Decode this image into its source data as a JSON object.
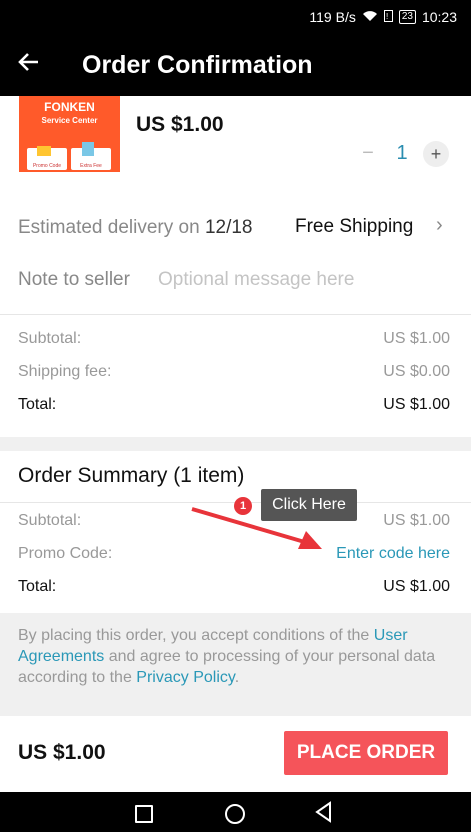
{
  "status_bar": {
    "speed": "119 B/s",
    "battery": "23",
    "time": "10:23"
  },
  "header": {
    "title": "Order Confirmation"
  },
  "product": {
    "image_brand": "FONKEN",
    "image_subtitle": "Service Center",
    "image_tag_left": "Promo Code",
    "image_tag_right": "Extra Fee",
    "price": "US $1.00",
    "qty_minus": "−",
    "quantity": "1",
    "qty_plus": "+"
  },
  "delivery": {
    "label": "Estimated delivery on",
    "date": "12/18",
    "shipping": "Free Shipping",
    "chevron": "›"
  },
  "note": {
    "label": "Note to seller",
    "placeholder": "Optional message here"
  },
  "totals": {
    "subtotal_label": "Subtotal:",
    "subtotal_value": "US $1.00",
    "shipping_label": "Shipping fee:",
    "shipping_value": "US $0.00",
    "total_label": "Total:",
    "total_value": "US $1.00"
  },
  "summary": {
    "title": "Order Summary (1 item)",
    "subtotal_label": "Subtotal:",
    "subtotal_value": "US $1.00",
    "promo_label": "Promo Code:",
    "promo_link": "Enter code here",
    "total_label": "Total:",
    "total_value": "US $1.00"
  },
  "overlay": {
    "badge": "1",
    "tooltip": "Click Here",
    "accent": "#e8343a"
  },
  "terms": {
    "text1": "By placing this order, you accept conditions of the ",
    "link1": "User Agreements",
    "text2": " and agree to processing of your personal data according to the ",
    "link2": "Privacy Policy",
    "text3": "."
  },
  "bottom": {
    "total": "US $1.00",
    "place_order": "PLACE ORDER"
  },
  "colors": {
    "accent_button": "#f5545a",
    "link": "#2a98b7"
  }
}
